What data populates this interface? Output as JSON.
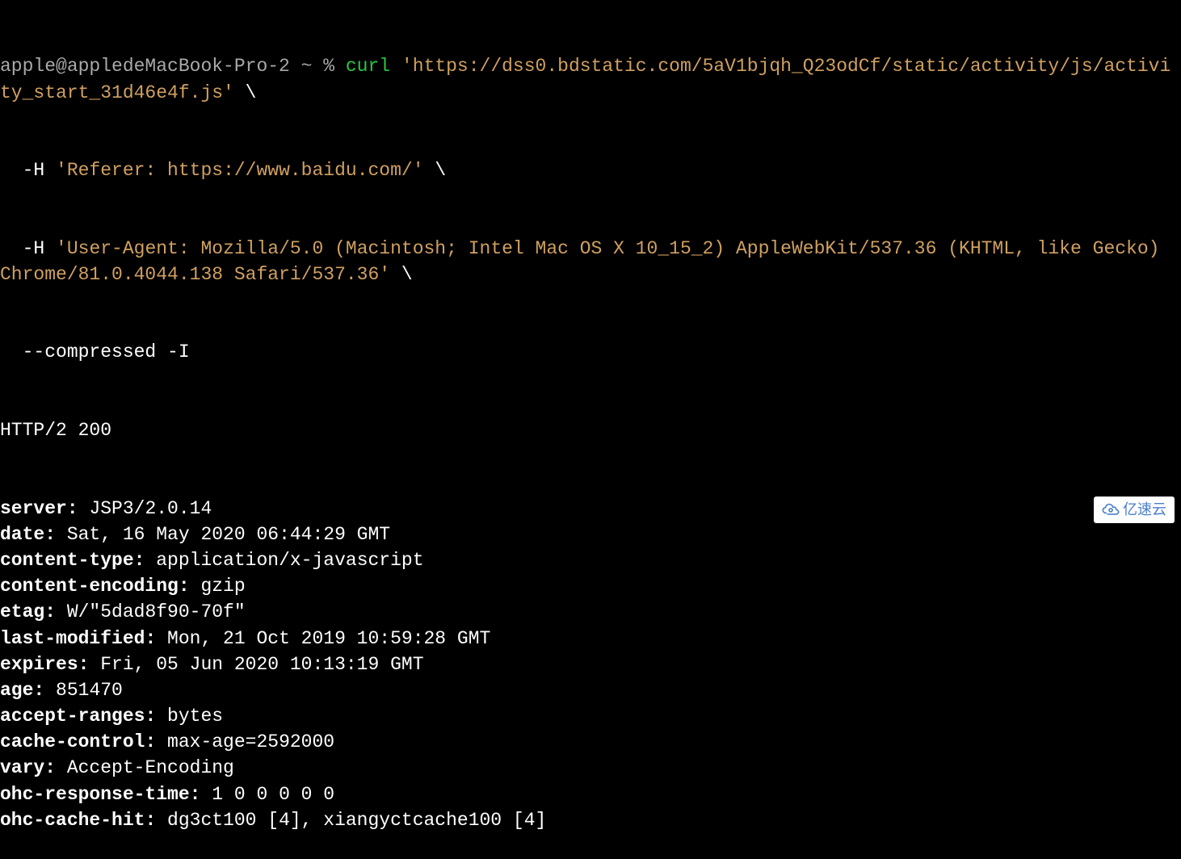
{
  "prompt": "apple@appledeMacBook-Pro-2 ~ % ",
  "command": {
    "name": "curl",
    "url": "'https://dss0.bdstatic.com/5aV1bjqh_Q23odCf/static/activity/js/activity_start_31d46e4f.js'",
    "cont": " \\",
    "h1_flag": "  -H ",
    "h1_val": "'Referer: https://www.baidu.com/'",
    "h2_flag": "  -H ",
    "h2_val": "'User-Agent: Mozilla/5.0 (Macintosh; Intel Mac OS X 10_15_2) AppleWebKit/537.36 (KHTML, like Gecko) Chrome/81.0.4044.138 Safari/537.36'",
    "final": "  --compressed -I"
  },
  "response": {
    "status": "HTTP/2 200",
    "headers": [
      {
        "name": "server",
        "value": "JSP3/2.0.14"
      },
      {
        "name": "date",
        "value": "Sat, 16 May 2020 06:44:29 GMT"
      },
      {
        "name": "content-type",
        "value": "application/x-javascript"
      },
      {
        "name": "content-encoding",
        "value": "gzip"
      },
      {
        "name": "etag",
        "value": "W/\"5dad8f90-70f\""
      },
      {
        "name": "last-modified",
        "value": "Mon, 21 Oct 2019 10:59:28 GMT"
      },
      {
        "name": "expires",
        "value": "Fri, 05 Jun 2020 10:13:19 GMT"
      },
      {
        "name": "age",
        "value": "851470"
      },
      {
        "name": "accept-ranges",
        "value": "bytes"
      },
      {
        "name": "cache-control",
        "value": "max-age=2592000"
      },
      {
        "name": "vary",
        "value": "Accept-Encoding"
      },
      {
        "name": "ohc-response-time",
        "value": "1 0 0 0 0 0"
      },
      {
        "name": "ohc-cache-hit",
        "value": "dg3ct100 [4], xiangyctcache100 [4]"
      }
    ]
  },
  "watermark": "亿速云"
}
